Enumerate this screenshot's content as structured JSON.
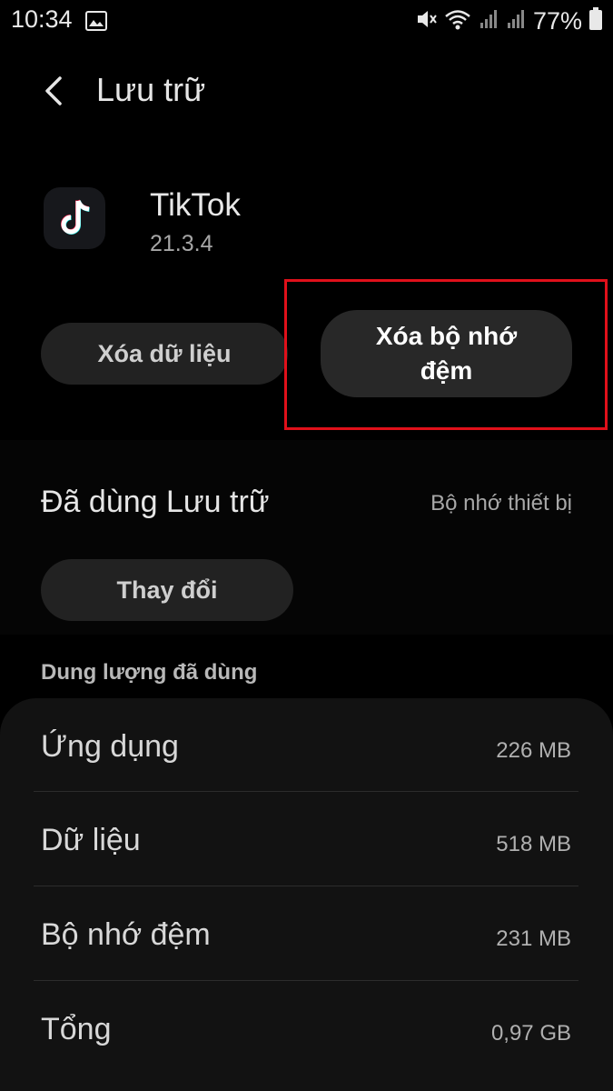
{
  "status_bar": {
    "time": "10:34",
    "battery_percent": "77%",
    "icons": [
      "image-icon",
      "mute-icon",
      "wifi-icon",
      "signal-icon",
      "signal-icon",
      "battery-icon"
    ]
  },
  "header": {
    "title": "Lưu trữ"
  },
  "app": {
    "name": "TikTok",
    "version": "21.3.4"
  },
  "actions": {
    "clear_data": "Xóa dữ liệu",
    "clear_cache": "Xóa bộ nhớ đệm"
  },
  "storage": {
    "label": "Đã dùng Lưu trữ",
    "value": "Bộ nhớ thiết bị",
    "change_button": "Thay đổi"
  },
  "usage": {
    "header": "Dung lượng đã dùng",
    "rows": [
      {
        "label": "Ứng dụng",
        "value": "226 MB"
      },
      {
        "label": "Dữ liệu",
        "value": "518 MB"
      },
      {
        "label": "Bộ nhớ đệm",
        "value": "231 MB"
      },
      {
        "label": "Tổng",
        "value": "0,97 GB"
      }
    ]
  },
  "colors": {
    "background": "#000000",
    "highlight_border": "#e0101a",
    "pill": "#222222"
  }
}
